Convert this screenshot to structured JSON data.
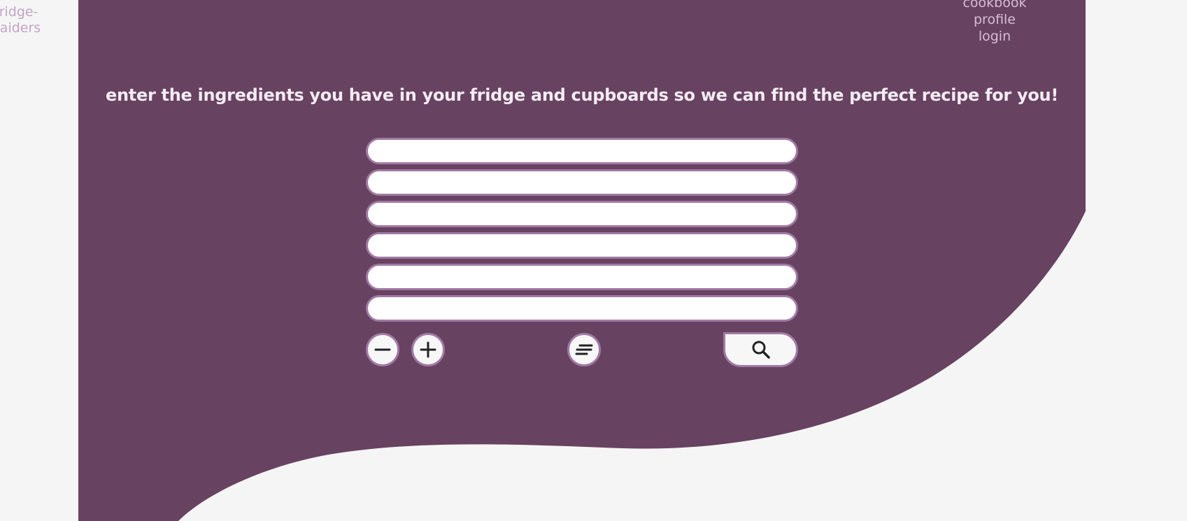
{
  "brand": {
    "line1": "fridge-",
    "line2": "raiders"
  },
  "nav": {
    "items": [
      {
        "label": "cookbook"
      },
      {
        "label": "profile"
      },
      {
        "label": "login"
      }
    ]
  },
  "main": {
    "heading": "enter the ingredients you have in your fridge and cupboards so we can find the perfect recipe for you!",
    "ingredient_fields": [
      {
        "value": "",
        "placeholder": ""
      },
      {
        "value": "",
        "placeholder": ""
      },
      {
        "value": "",
        "placeholder": ""
      },
      {
        "value": "",
        "placeholder": ""
      },
      {
        "value": "",
        "placeholder": ""
      },
      {
        "value": "",
        "placeholder": ""
      }
    ],
    "controls": {
      "remove_icon": "minus-icon",
      "add_icon": "plus-icon",
      "filter_icon": "filter-lines-icon",
      "search_icon": "search-icon"
    }
  },
  "colors": {
    "background": "#f5f5f5",
    "panel": "#684261",
    "field_border": "#a07aa4",
    "heading_text": "#f3ecf4",
    "nav_text": "#d4bed6",
    "brand_text": "#c3a5c6",
    "icon": "#222222"
  }
}
